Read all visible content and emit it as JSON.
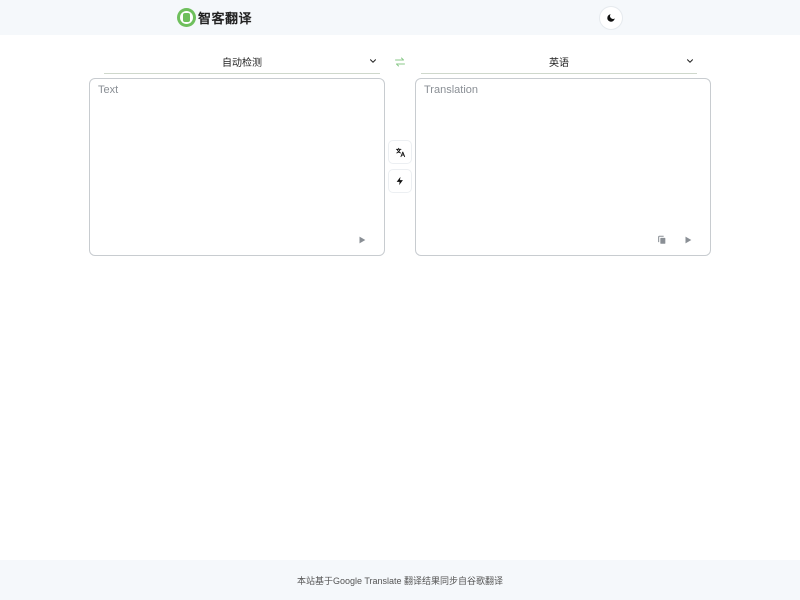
{
  "header": {
    "logo_text": "智客翻译",
    "theme_toggle_icon": "moon-icon"
  },
  "translator": {
    "source_language": "自动检测",
    "target_language": "英语",
    "swap_icon": "swap-arrows-icon",
    "source_placeholder": "Text",
    "target_placeholder": "Translation",
    "translate_icon": "translate-icon",
    "instant_icon": "lightning-icon",
    "accent_color": "#8bc98a"
  },
  "footer": {
    "text": "本站基于Google Translate 翻译结果同步自谷歌翻译"
  }
}
